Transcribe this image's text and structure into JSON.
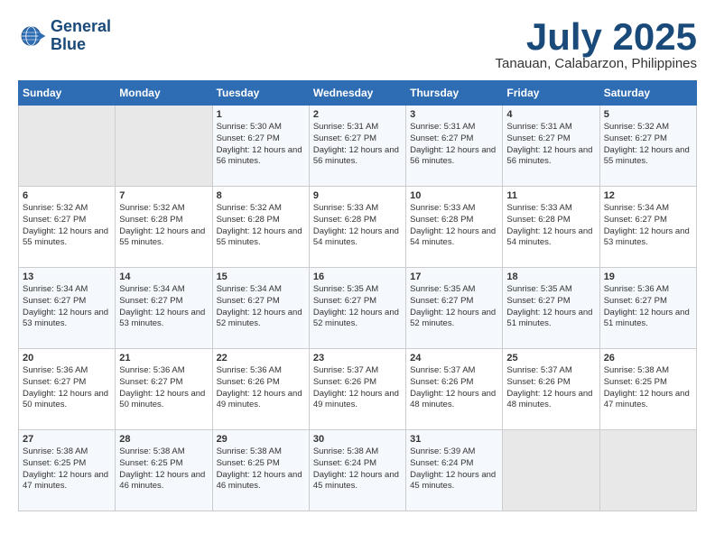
{
  "logo": {
    "line1": "General",
    "line2": "Blue"
  },
  "title": "July 2025",
  "subtitle": "Tanauan, Calabarzon, Philippines",
  "days_of_week": [
    "Sunday",
    "Monday",
    "Tuesday",
    "Wednesday",
    "Thursday",
    "Friday",
    "Saturday"
  ],
  "weeks": [
    [
      {
        "day": "",
        "info": ""
      },
      {
        "day": "",
        "info": ""
      },
      {
        "day": "1",
        "info": "Sunrise: 5:30 AM\nSunset: 6:27 PM\nDaylight: 12 hours and 56 minutes."
      },
      {
        "day": "2",
        "info": "Sunrise: 5:31 AM\nSunset: 6:27 PM\nDaylight: 12 hours and 56 minutes."
      },
      {
        "day": "3",
        "info": "Sunrise: 5:31 AM\nSunset: 6:27 PM\nDaylight: 12 hours and 56 minutes."
      },
      {
        "day": "4",
        "info": "Sunrise: 5:31 AM\nSunset: 6:27 PM\nDaylight: 12 hours and 56 minutes."
      },
      {
        "day": "5",
        "info": "Sunrise: 5:32 AM\nSunset: 6:27 PM\nDaylight: 12 hours and 55 minutes."
      }
    ],
    [
      {
        "day": "6",
        "info": "Sunrise: 5:32 AM\nSunset: 6:27 PM\nDaylight: 12 hours and 55 minutes."
      },
      {
        "day": "7",
        "info": "Sunrise: 5:32 AM\nSunset: 6:28 PM\nDaylight: 12 hours and 55 minutes."
      },
      {
        "day": "8",
        "info": "Sunrise: 5:32 AM\nSunset: 6:28 PM\nDaylight: 12 hours and 55 minutes."
      },
      {
        "day": "9",
        "info": "Sunrise: 5:33 AM\nSunset: 6:28 PM\nDaylight: 12 hours and 54 minutes."
      },
      {
        "day": "10",
        "info": "Sunrise: 5:33 AM\nSunset: 6:28 PM\nDaylight: 12 hours and 54 minutes."
      },
      {
        "day": "11",
        "info": "Sunrise: 5:33 AM\nSunset: 6:28 PM\nDaylight: 12 hours and 54 minutes."
      },
      {
        "day": "12",
        "info": "Sunrise: 5:34 AM\nSunset: 6:27 PM\nDaylight: 12 hours and 53 minutes."
      }
    ],
    [
      {
        "day": "13",
        "info": "Sunrise: 5:34 AM\nSunset: 6:27 PM\nDaylight: 12 hours and 53 minutes."
      },
      {
        "day": "14",
        "info": "Sunrise: 5:34 AM\nSunset: 6:27 PM\nDaylight: 12 hours and 53 minutes."
      },
      {
        "day": "15",
        "info": "Sunrise: 5:34 AM\nSunset: 6:27 PM\nDaylight: 12 hours and 52 minutes."
      },
      {
        "day": "16",
        "info": "Sunrise: 5:35 AM\nSunset: 6:27 PM\nDaylight: 12 hours and 52 minutes."
      },
      {
        "day": "17",
        "info": "Sunrise: 5:35 AM\nSunset: 6:27 PM\nDaylight: 12 hours and 52 minutes."
      },
      {
        "day": "18",
        "info": "Sunrise: 5:35 AM\nSunset: 6:27 PM\nDaylight: 12 hours and 51 minutes."
      },
      {
        "day": "19",
        "info": "Sunrise: 5:36 AM\nSunset: 6:27 PM\nDaylight: 12 hours and 51 minutes."
      }
    ],
    [
      {
        "day": "20",
        "info": "Sunrise: 5:36 AM\nSunset: 6:27 PM\nDaylight: 12 hours and 50 minutes."
      },
      {
        "day": "21",
        "info": "Sunrise: 5:36 AM\nSunset: 6:27 PM\nDaylight: 12 hours and 50 minutes."
      },
      {
        "day": "22",
        "info": "Sunrise: 5:36 AM\nSunset: 6:26 PM\nDaylight: 12 hours and 49 minutes."
      },
      {
        "day": "23",
        "info": "Sunrise: 5:37 AM\nSunset: 6:26 PM\nDaylight: 12 hours and 49 minutes."
      },
      {
        "day": "24",
        "info": "Sunrise: 5:37 AM\nSunset: 6:26 PM\nDaylight: 12 hours and 48 minutes."
      },
      {
        "day": "25",
        "info": "Sunrise: 5:37 AM\nSunset: 6:26 PM\nDaylight: 12 hours and 48 minutes."
      },
      {
        "day": "26",
        "info": "Sunrise: 5:38 AM\nSunset: 6:25 PM\nDaylight: 12 hours and 47 minutes."
      }
    ],
    [
      {
        "day": "27",
        "info": "Sunrise: 5:38 AM\nSunset: 6:25 PM\nDaylight: 12 hours and 47 minutes."
      },
      {
        "day": "28",
        "info": "Sunrise: 5:38 AM\nSunset: 6:25 PM\nDaylight: 12 hours and 46 minutes."
      },
      {
        "day": "29",
        "info": "Sunrise: 5:38 AM\nSunset: 6:25 PM\nDaylight: 12 hours and 46 minutes."
      },
      {
        "day": "30",
        "info": "Sunrise: 5:38 AM\nSunset: 6:24 PM\nDaylight: 12 hours and 45 minutes."
      },
      {
        "day": "31",
        "info": "Sunrise: 5:39 AM\nSunset: 6:24 PM\nDaylight: 12 hours and 45 minutes."
      },
      {
        "day": "",
        "info": ""
      },
      {
        "day": "",
        "info": ""
      }
    ]
  ]
}
